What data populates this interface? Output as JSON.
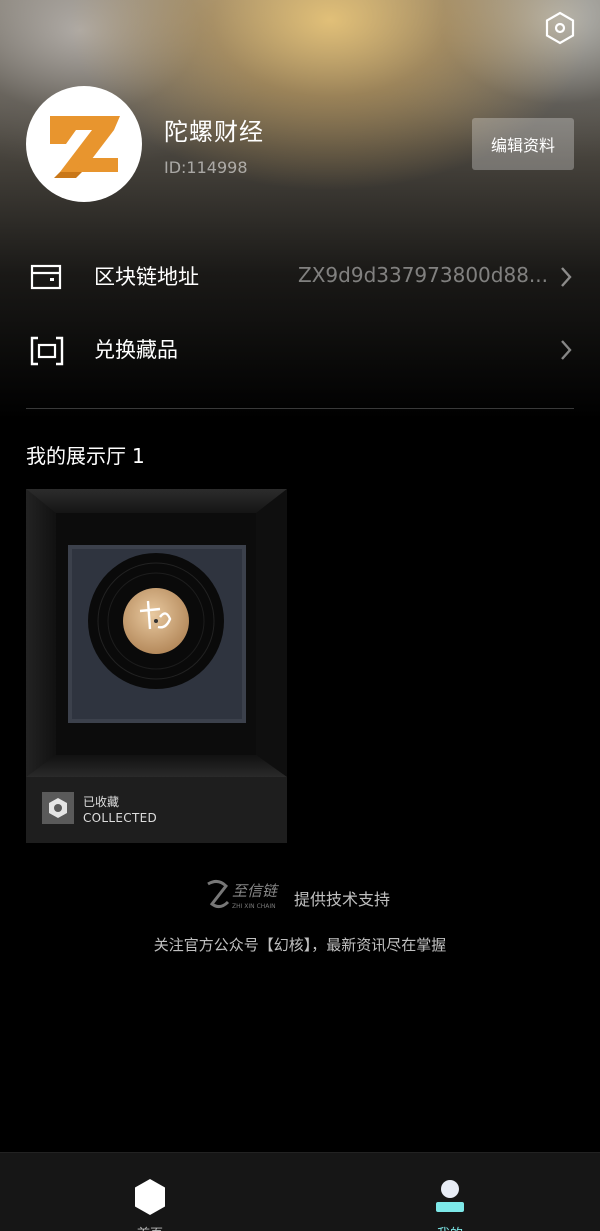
{
  "profile": {
    "name": "陀螺财经",
    "id_text": "ID:114998",
    "avatar_letter": "Z",
    "edit_button_label": "编辑资料"
  },
  "menu": {
    "chain_address": {
      "label": "区块链地址",
      "value": "ZX9d9d337973800d88..."
    },
    "redeem": {
      "label": "兑换藏品"
    }
  },
  "gallery": {
    "title": "我的展示厅",
    "count": "1",
    "items": [
      {
        "status_cn": "已收藏",
        "status_en": "COLLECTED"
      }
    ]
  },
  "footer": {
    "support_text": "提供技术支持",
    "notice": "关注官方公众号【幻核】，最新资讯尽在掌握"
  },
  "tabbar": {
    "tabs": [
      {
        "label": "首页",
        "icon": "hexagon-icon"
      },
      {
        "label": "我的",
        "icon": "user-icon"
      }
    ],
    "active_color": "#7de8e8"
  },
  "colors": {
    "avatar_orange": "#e8952e",
    "background": "#000000"
  }
}
